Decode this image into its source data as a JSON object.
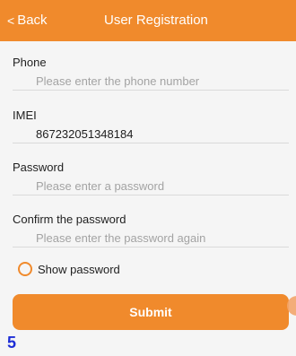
{
  "header": {
    "back_label": "Back",
    "back_icon": "chevron-left-icon",
    "back_glyph": "<",
    "title": "User Registration",
    "color": "#f08a2c"
  },
  "form": {
    "phone": {
      "label": "Phone",
      "placeholder": "Please enter the phone number",
      "value": ""
    },
    "imei": {
      "label": "IMEI",
      "value": "867232051348184"
    },
    "password": {
      "label": "Password",
      "placeholder": "Please enter a password",
      "value": ""
    },
    "confirm_password": {
      "label": "Confirm the password",
      "placeholder": "Please enter the password again",
      "value": ""
    },
    "show_password": {
      "label": "Show password",
      "checked": false
    },
    "submit_label": "Submit"
  },
  "overlay": {
    "marker": "5"
  },
  "colors": {
    "accent": "#f08a2c",
    "marker": "#1d2dd6"
  }
}
